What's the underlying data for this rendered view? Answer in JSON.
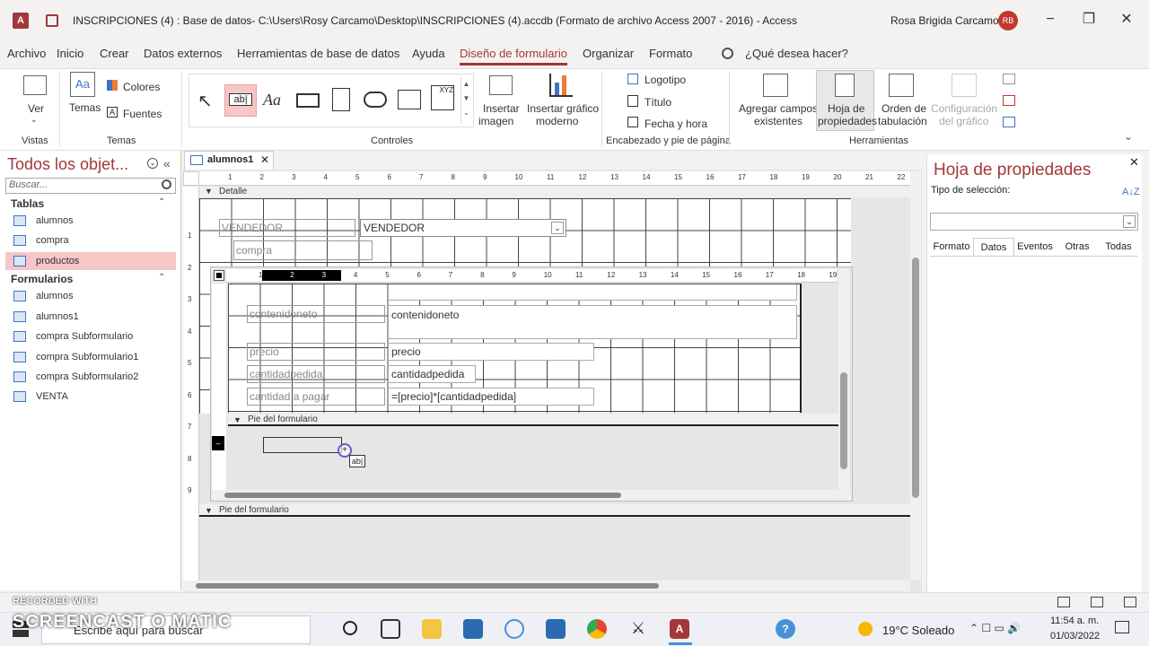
{
  "window": {
    "title": "INSCRIPCIONES (4) : Base de datos- C:\\Users\\Rosy Carcamo\\Desktop\\INSCRIPCIONES (4).accdb (Formato de archivo Access 2007 - 2016)  -  Access",
    "app_letter": "A",
    "user_name": "Rosa Brigida Carcamo",
    "user_initials": "RB"
  },
  "menu": [
    "Archivo",
    "Inicio",
    "Crear",
    "Datos externos",
    "Herramientas de base de datos",
    "Ayuda",
    "Diseño de formulario",
    "Organizar",
    "Formato"
  ],
  "menu_search": "¿Qué desea hacer?",
  "ribbon": {
    "ver": "Ver",
    "vistas": "Vistas",
    "temas_btn": "Temas",
    "colores": "Colores",
    "fuentes": "Fuentes",
    "temas_group": "Temas",
    "controles_group": "Controles",
    "insertar_imagen": [
      "Insertar",
      "imagen"
    ],
    "insertar_grafico": [
      "Insertar gráfico",
      "moderno"
    ],
    "logotipo": "Logotipo",
    "titulo": "Título",
    "fecha_hora": "Fecha y hora",
    "encabezado_group": "Encabezado y pie de página",
    "agregar_campos": [
      "Agregar campos",
      "existentes"
    ],
    "hoja_propiedades": [
      "Hoja de",
      "propiedades"
    ],
    "orden_tab": [
      "Orden de",
      "tabulación"
    ],
    "config_grafico": [
      "Configuración",
      "del gráfico"
    ],
    "herramientas_group": "Herramientas",
    "xyz": "XYZ",
    "aa": "Aa",
    "ab": "ab|"
  },
  "nav": {
    "header": "Todos los objet...",
    "search_placeholder": "Buscar...",
    "tablas_label": "Tablas",
    "tablas": [
      "alumnos",
      "compra",
      "productos"
    ],
    "formularios_label": "Formularios",
    "formularios": [
      "alumnos",
      "alumnos1",
      "compra Subformulario",
      "compra Subformulario1",
      "compra Subformulario2",
      "VENTA"
    ]
  },
  "document": {
    "tab": "alumnos1",
    "detalle": "Detalle",
    "vendedor_label": "VENDEDOR",
    "vendedor_combo": "VENDEDOR",
    "compra_label": "compra",
    "sub_fields": [
      {
        "label": "contenidoneto",
        "box": "contenidoneto"
      },
      {
        "label": "precio",
        "box": "precio"
      },
      {
        "label": "cantidadpedida",
        "box": "cantidadpedida"
      },
      {
        "label": "cantidad a pagar",
        "box": "=[precio]*[cantidadpedida]"
      }
    ],
    "pie_sub": "Pie del formulario",
    "pie_main": "Pie del formulario",
    "cursor_tag": "ab|",
    "ruler_numbers": [
      "1",
      "2",
      "3",
      "4",
      "5",
      "6",
      "7",
      "8",
      "9",
      "10",
      "11",
      "12",
      "13",
      "14",
      "15",
      "16",
      "17",
      "18",
      "19",
      "20",
      "21",
      "22"
    ],
    "sub_ruler_numbers": [
      "1",
      "2",
      "3",
      "4",
      "5",
      "6",
      "7",
      "8",
      "9",
      "10",
      "11",
      "12",
      "13",
      "14",
      "15",
      "16",
      "17",
      "18",
      "19"
    ],
    "vruler_numbers": [
      "1",
      "2",
      "3",
      "4",
      "5",
      "6",
      "7",
      "8",
      "9"
    ]
  },
  "props": {
    "title": "Hoja de propiedades",
    "tipo": "Tipo de selección:",
    "sort_icon": "A↓Z",
    "tabs": [
      "Formato",
      "Datos",
      "Eventos",
      "Otras",
      "Todas"
    ],
    "active_tab": "Datos"
  },
  "taskbar": {
    "search": "Escribe aquí para buscar",
    "weather": "19°C  Soleado",
    "time": "11:54 a. m.",
    "date": "01/03/2022",
    "recorded": "RECORDED WITH",
    "brand": "SCREENCAST O MATIC"
  },
  "colors": {
    "accent": "#a4373a",
    "selected_nav": "#f7c6c7"
  }
}
